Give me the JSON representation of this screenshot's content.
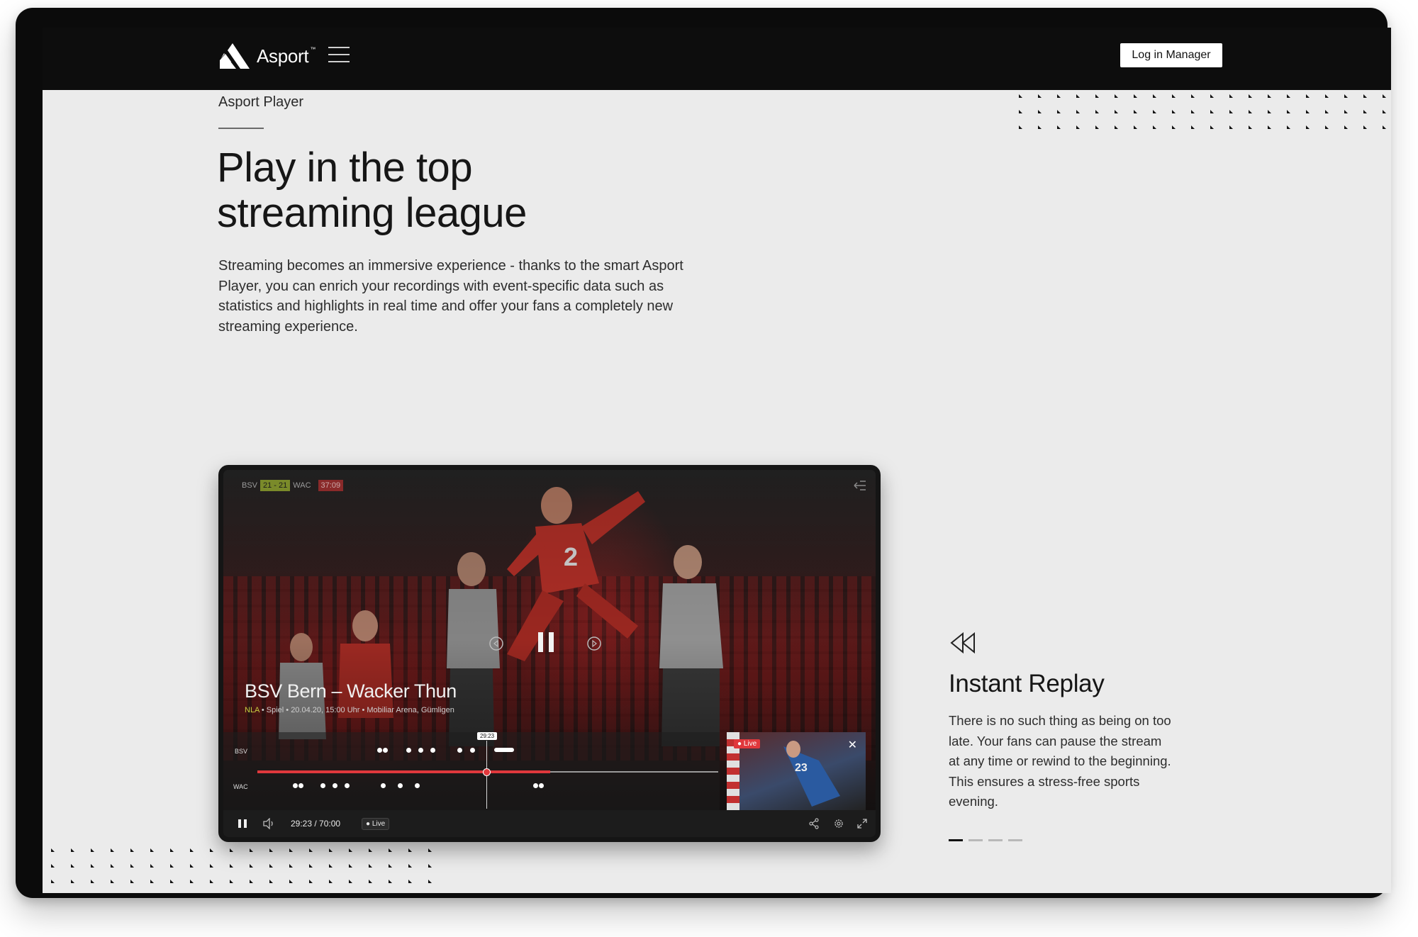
{
  "nav": {
    "brand": "Asport",
    "brand_mark": "™",
    "login_label": "Log in Manager"
  },
  "hero": {
    "eyebrow": "Asport Player",
    "title_line1": "Play in the top",
    "title_line2": "streaming league",
    "body": "Streaming becomes an immersive experience - thanks to the smart Asport Player, you can enrich your recordings with event-specific data such as statistics and highlights in real time and offer your fans a completely new streaming experience."
  },
  "player": {
    "home_team": "BSV",
    "score": "21 - 21",
    "away_team": "WAC",
    "game_clock": "37:09",
    "match_title": "BSV Bern – Wacker Thun",
    "league": "NLA",
    "match_meta": "• Spiel • 20.04.20, 15:00 Uhr • Mobiliar Arena, Gümligen",
    "timeline_home": "BSV",
    "timeline_away": "WAC",
    "hover_time": "29:23",
    "time_display": "29:23 / 70:00",
    "live_label": "Live",
    "pip_live_label": "Live",
    "jersey_number": "2",
    "pip_jersey_number": "23",
    "progress_fraction": 0.42
  },
  "feature": {
    "title": "Instant Replay",
    "body": "There is no such thing as being on too late. Your fans can pause the stream at any time or rewind to the beginning. This ensures a stress-free sports evening.",
    "pages": 4,
    "active_page": 0
  },
  "icons": {
    "menu": "hamburger-icon",
    "feature": "rewind-icon",
    "pause": "pause-icon",
    "volume": "volume-icon",
    "share": "share-icon",
    "settings": "gear-icon",
    "fullscreen": "expand-icon",
    "exit": "exit-icon",
    "rewind10": "rewind-10-icon",
    "forward10": "forward-10-icon",
    "close": "close-icon"
  }
}
